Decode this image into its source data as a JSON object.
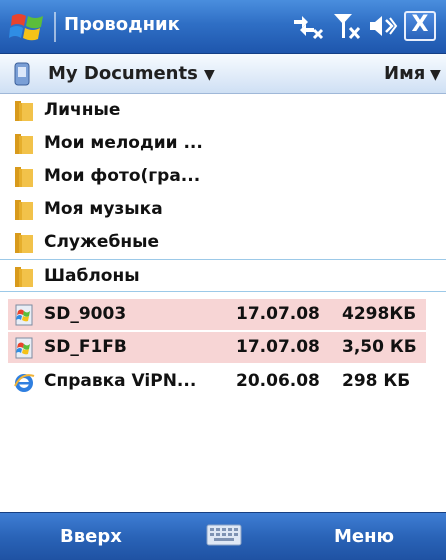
{
  "titlebar": {
    "title": "Проводник",
    "close_label": "X",
    "icons": [
      "windows-start-icon",
      "connectivity-icon",
      "signal-off-icon",
      "volume-muted-icon"
    ]
  },
  "locationbar": {
    "folder": "My Documents",
    "sort": "Имя",
    "icons": [
      "document-icon",
      "chevron-down-icon"
    ]
  },
  "files": [
    {
      "name": "Личные",
      "date": "",
      "size": "",
      "icon": "folder-icon"
    },
    {
      "name": "Мои мелодии ...",
      "date": "",
      "size": "",
      "icon": "folder-icon"
    },
    {
      "name": "Мои фото(гра...",
      "date": "",
      "size": "",
      "icon": "folder-icon"
    },
    {
      "name": "Моя музыка",
      "date": "",
      "size": "",
      "icon": "folder-icon"
    },
    {
      "name": "Служебные",
      "date": "",
      "size": "",
      "icon": "folder-icon"
    },
    {
      "name": "Шаблоны",
      "date": "",
      "size": "",
      "icon": "folder-icon"
    },
    {
      "name": "SD_9003",
      "date": "17.07.08",
      "size": "4298КБ",
      "icon": "media-file-icon"
    },
    {
      "name": "SD_F1FB",
      "date": "17.07.08",
      "size": "3,50 КБ",
      "icon": "media-file-icon"
    },
    {
      "name": "Справка ViPN...",
      "date": "20.06.08",
      "size": "298 КБ",
      "icon": "ie-file-icon"
    }
  ],
  "softkeys": {
    "left": "Вверх",
    "right": "Меню",
    "center_icon": "keyboard-icon"
  },
  "colors": {
    "titlebar": "#2f6fc5",
    "highlight": "#f7d5d5",
    "selection_line": "#9cc9e8",
    "folder": "#f2c24a"
  }
}
